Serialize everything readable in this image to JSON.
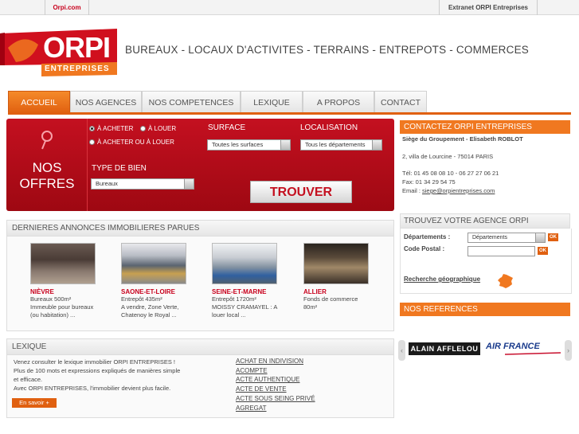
{
  "topbar": {
    "left_link": "Orpi.com",
    "right_link": "Extranet ORPI Entreprises"
  },
  "logo": {
    "top": "ORPI",
    "bottom": "ENTREPRISES"
  },
  "tagline": "BUREAUX - LOCAUX D'ACTIVITES - TERRAINS - ENTREPOTS - COMMERCES",
  "nav": [
    "ACCUEIL",
    "NOS AGENCES",
    "NOS COMPETENCES",
    "LEXIQUE",
    "A PROPOS",
    "CONTACT"
  ],
  "offers": {
    "title_line1": "NOS",
    "title_line2": "OFFRES",
    "radio_acheter": "À ACHETER",
    "radio_louer": "À LOUER",
    "radio_both": "À ACHETER OU À LOUER",
    "type_label": "TYPE DE BIEN",
    "type_value": "Bureaux",
    "surface_label": "SURFACE",
    "surface_value": "Toutes les surfaces",
    "loc_label": "LOCALISATION",
    "loc_value": "Tous les départements",
    "search_button": "TROUVER"
  },
  "annonces": {
    "title": "DERNIERES ANNONCES IMMOBILIERES PARUES",
    "items": [
      {
        "dep": "NIÈVRE",
        "l1": "Bureaux 500m²",
        "l2": "Immeuble pour bureaux",
        "l3": "(ou habitation) ..."
      },
      {
        "dep": "SAONE-ET-LOIRE",
        "l1": "Entrepôt 435m²",
        "l2": "A vendre, Zone Verte,",
        "l3": "Chatenoy le Royal ..."
      },
      {
        "dep": "SEINE-ET-MARNE",
        "l1": "Entrepôt 1720m²",
        "l2": "MOISSY CRAMAYEL : A",
        "l3": "louer local ..."
      },
      {
        "dep": "ALLIER",
        "l1": "Fonds de commerce",
        "l2": "80m²",
        "l3": ""
      }
    ]
  },
  "lexique": {
    "title": "LEXIQUE",
    "text1": "Venez consulter le lexique immobilier ORPI ENTREPRISES !",
    "text2": "Plus de 100 mots et expressions expliqués de manières simple",
    "text3": "et efficace.",
    "text4": "Avec ORPI ENTREPRISES, l'immobilier devient plus facile.",
    "button": "En savoir +",
    "links": [
      "ACHAT EN INDIVISION",
      "ACOMPTE",
      "ACTE AUTHENTIQUE",
      "ACTE DE VENTE",
      "ACTE SOUS SEING PRIVÉ",
      "AGREGAT"
    ]
  },
  "contact": {
    "title": "CONTACTEZ ORPI ENTREPRISES",
    "siege": "Siège du Groupement - Elisabeth ROBLOT",
    "address": "2, villa de Lourcine - 75014 PARIS",
    "tel": "Tél: 01 45 08 08 10 - 06 27 27 06 21",
    "fax": "Fax: 01 34 29 54 75",
    "email_label": "Email :",
    "email": "siege@orpientreprises.com"
  },
  "agence": {
    "title": "TROUVEZ VOTRE AGENCE ORPI ENTREPRISES",
    "dep_label": "Départements :",
    "dep_value": "Départements",
    "cp_label": "Code Postal :",
    "ok": "OK",
    "geo_link": "Recherche géographique"
  },
  "references": {
    "title": "NOS REFERENCES",
    "brand1": "ALAIN AFFLELOU",
    "brand2": "AIR FRANCE"
  },
  "colors": {
    "brand_red": "#c41020",
    "accent_orange": "#e06010"
  }
}
